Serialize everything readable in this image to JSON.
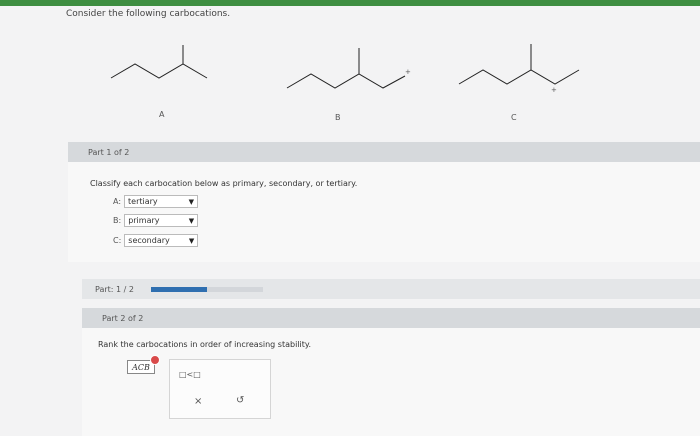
{
  "question": "Consider the following carbocations.",
  "structures": {
    "a_label": "A",
    "b_label": "B",
    "c_label": "C",
    "charge_symbol": "+"
  },
  "part1": {
    "header": "Part 1 of 2",
    "instruction": "Classify each carbocation below as primary, secondary, or tertiary.",
    "rows": [
      {
        "label": "A:",
        "value": "tertiary"
      },
      {
        "label": "B:",
        "value": "primary"
      },
      {
        "label": "C:",
        "value": "secondary"
      }
    ]
  },
  "progress": {
    "label": "Part: 1 / 2",
    "fraction": 0.5
  },
  "part2": {
    "header": "Part 2 of 2",
    "instruction": "Rank the carbocations in order of increasing stability.",
    "answer_tile": "ACB",
    "toolbox": {
      "order_template": "□<□",
      "clear_symbol": "×",
      "undo_symbol": "↺"
    }
  },
  "colors": {
    "accent_bar": "#3e8e41",
    "progress_fill": "#2f6fb0",
    "error_badge": "#d94a4a"
  }
}
